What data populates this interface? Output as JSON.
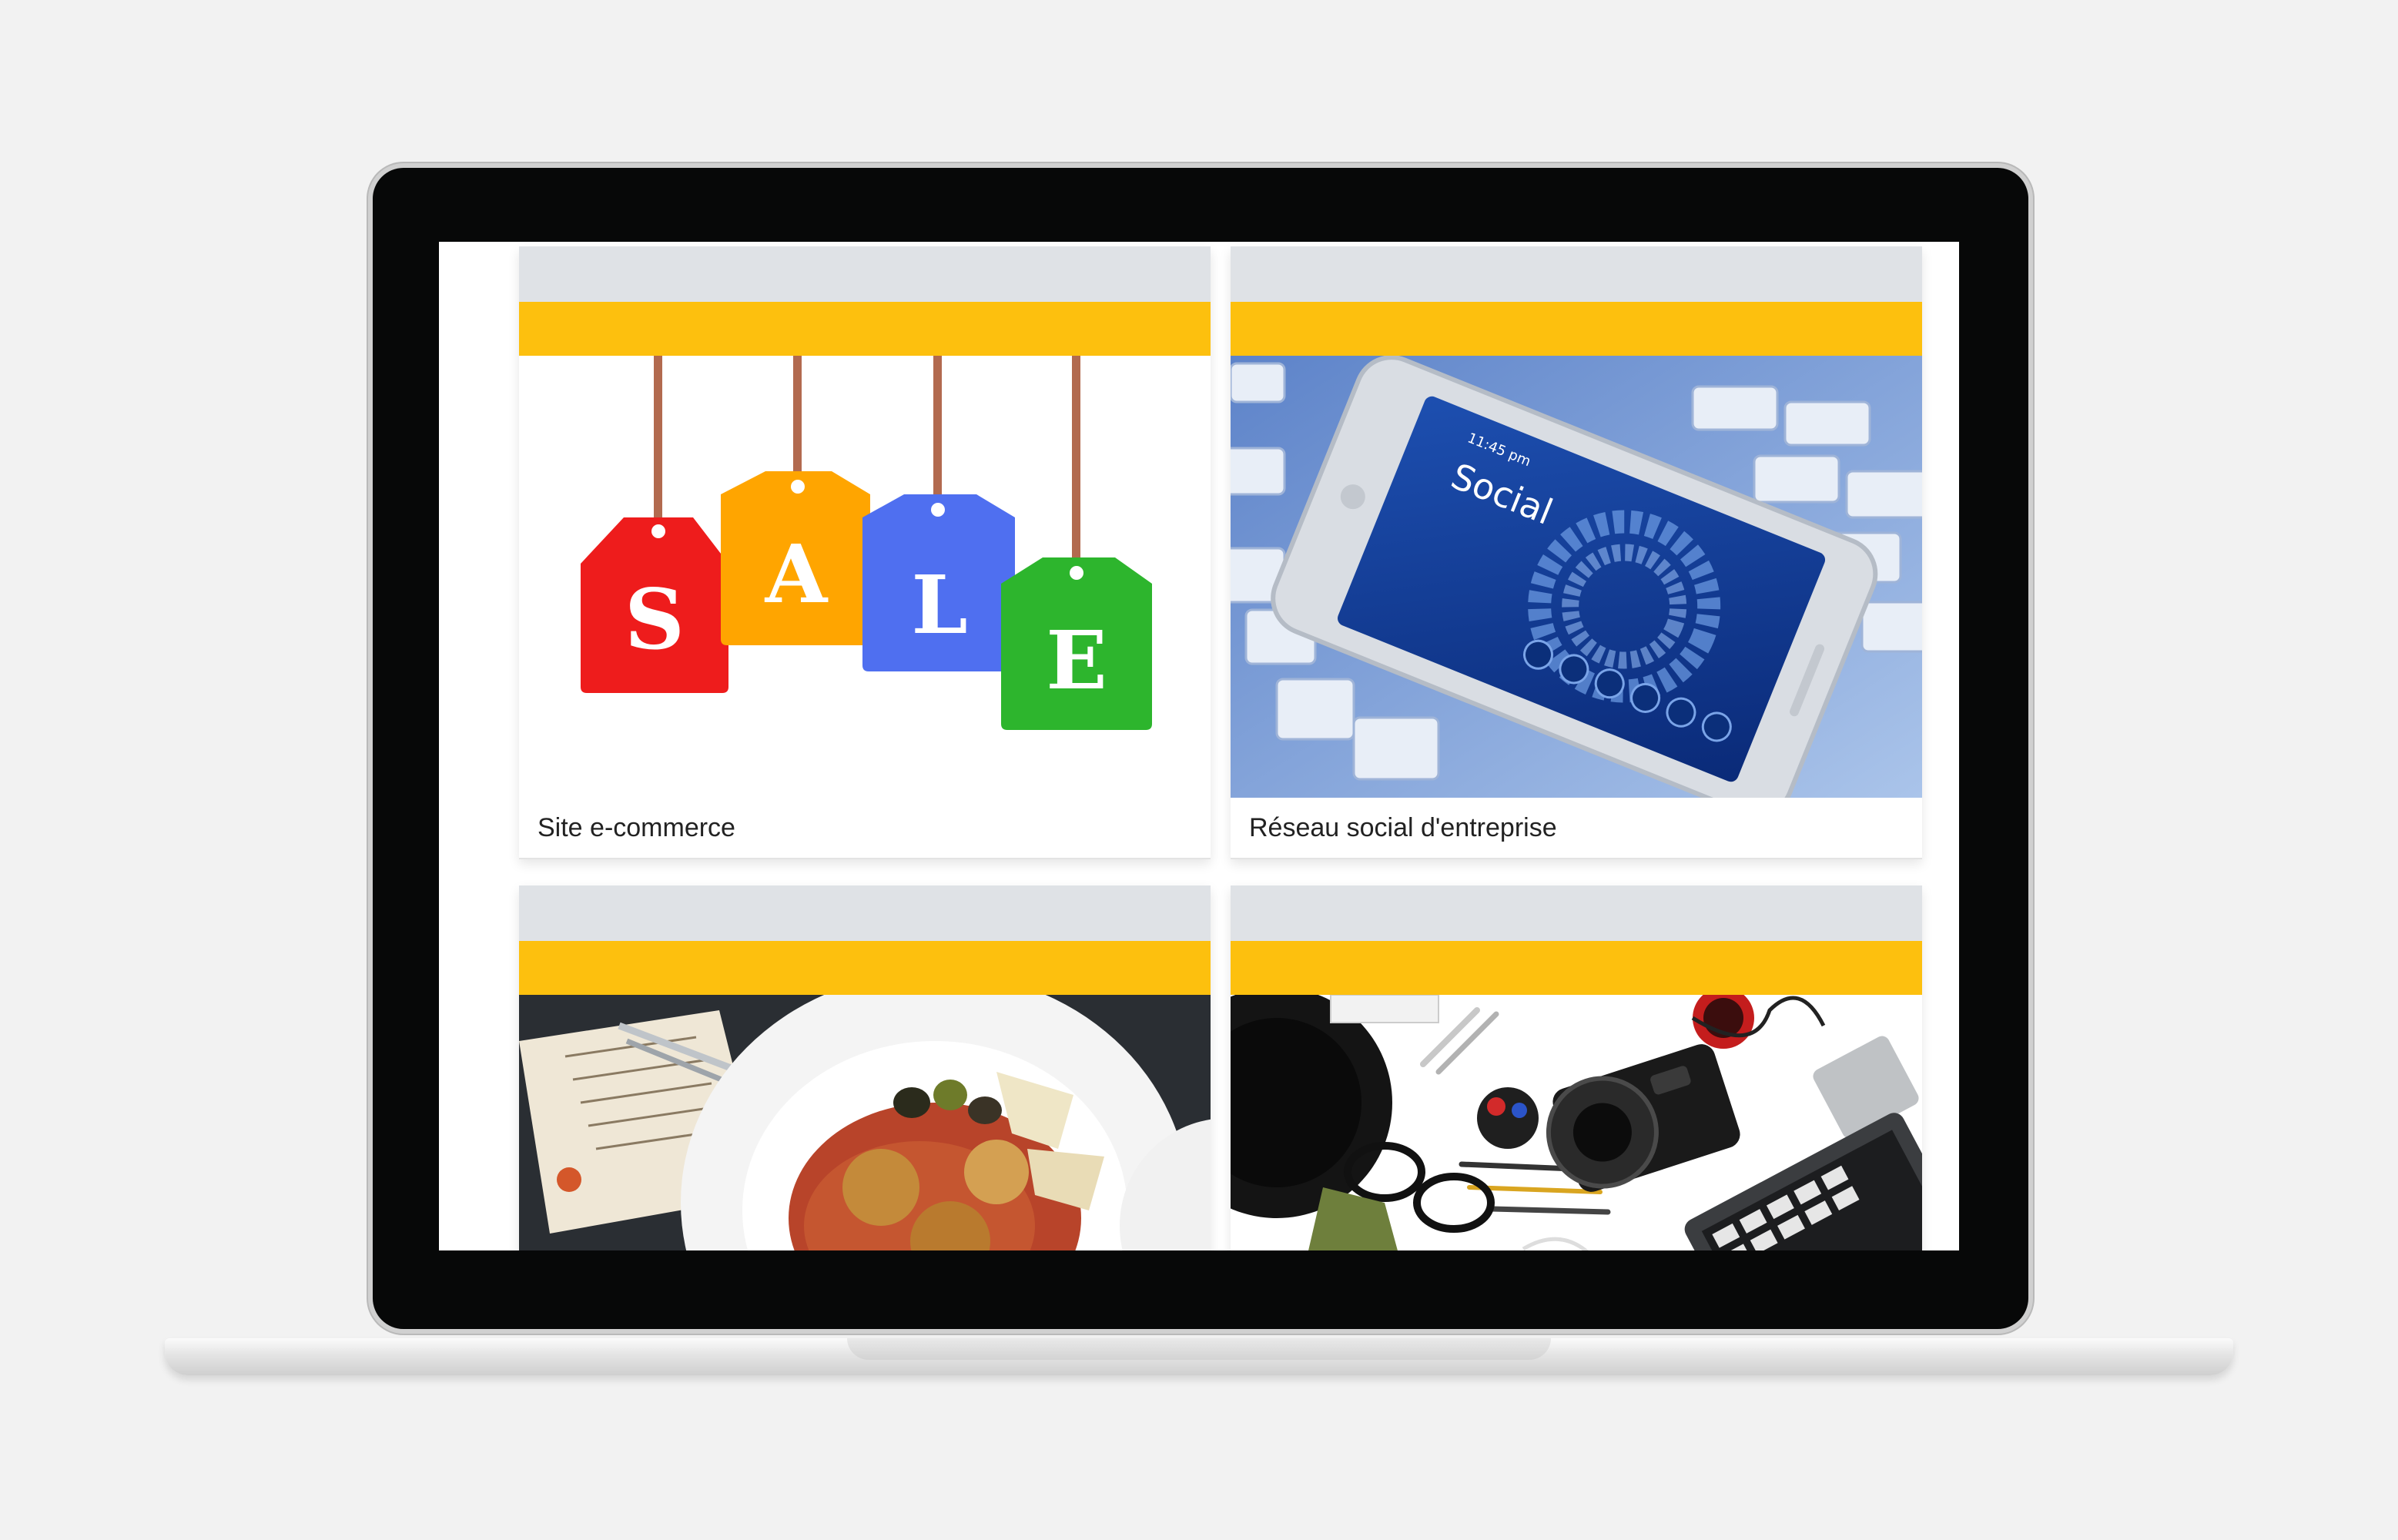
{
  "cards": [
    {
      "caption": "Site e-commerce",
      "image": {
        "type": "sale-tags",
        "letters": [
          "S",
          "A",
          "L",
          "E"
        ],
        "colors": [
          "#ee1c1c",
          "#ffa500",
          "#4f6ff0",
          "#2db52d"
        ]
      }
    },
    {
      "caption": "Réseau social d'entreprise",
      "image": {
        "type": "smartphone-on-keyboard",
        "screen_title": "Social",
        "screen_time": "11:45 pm"
      }
    },
    {
      "caption": "",
      "image": {
        "type": "food-plate"
      }
    },
    {
      "caption": "",
      "image": {
        "type": "office-desk-flatlay"
      }
    }
  ],
  "colors": {
    "card_top": "#dfe2e6",
    "card_stripe": "#fdc00e",
    "bezel": "#070808",
    "background": "#f2f2f2"
  }
}
